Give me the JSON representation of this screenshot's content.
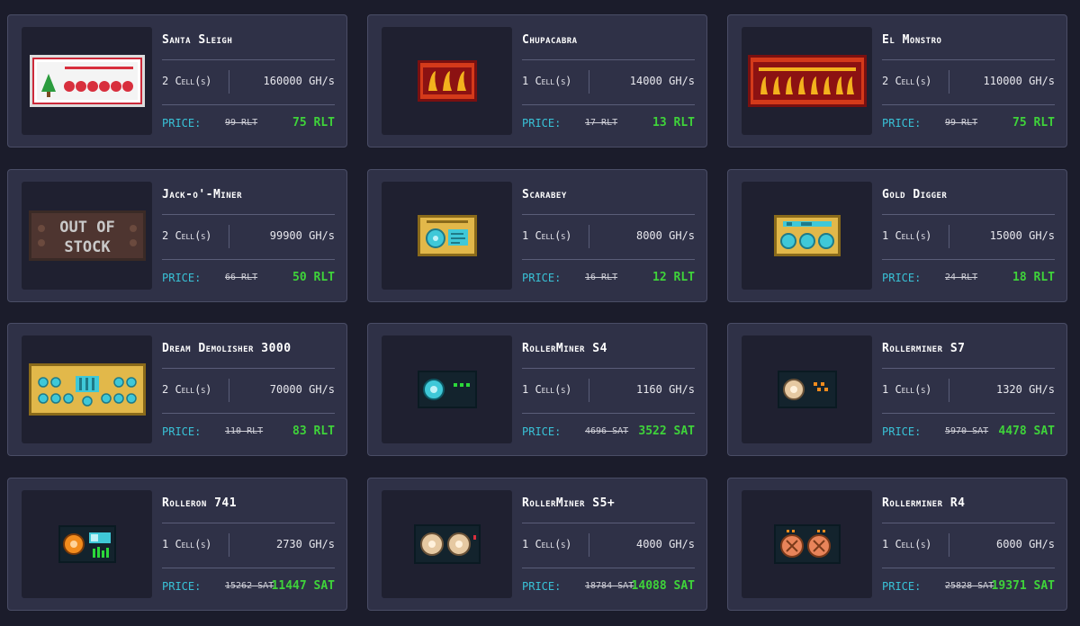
{
  "labels": {
    "price": "PRICE:"
  },
  "items": [
    {
      "name": "Santa Sleigh",
      "cells": "2 Cell(s)",
      "power": "160000 GH/s",
      "old_price": "99 RLT",
      "new_price": "75 RLT",
      "icon": "santa-sleigh-miner-icon"
    },
    {
      "name": "Chupacabra",
      "cells": "1 Cell(s)",
      "power": "14000 GH/s",
      "old_price": "17 RLT",
      "new_price": "13 RLT",
      "icon": "chupacabra-miner-icon"
    },
    {
      "name": "El Monstro",
      "cells": "2 Cell(s)",
      "power": "110000 GH/s",
      "old_price": "99 RLT",
      "new_price": "75 RLT",
      "icon": "el-monstro-miner-icon"
    },
    {
      "name": "Jack-o'-Miner",
      "cells": "2 Cell(s)",
      "power": "99900 GH/s",
      "old_price": "66 RLT",
      "new_price": "50 RLT",
      "icon": "out-of-stock-icon",
      "badge": "Out of Stock"
    },
    {
      "name": "Scarabey",
      "cells": "1 Cell(s)",
      "power": "8000 GH/s",
      "old_price": "16 RLT",
      "new_price": "12 RLT",
      "icon": "scarabey-miner-icon"
    },
    {
      "name": "Gold Digger",
      "cells": "1 Cell(s)",
      "power": "15000 GH/s",
      "old_price": "24 RLT",
      "new_price": "18 RLT",
      "icon": "gold-digger-miner-icon"
    },
    {
      "name": "Dream Demolisher 3000",
      "cells": "2 Cell(s)",
      "power": "70000 GH/s",
      "old_price": "110 RLT",
      "new_price": "83 RLT",
      "icon": "dream-demolisher-miner-icon"
    },
    {
      "name": "RollerMiner S4",
      "cells": "1 Cell(s)",
      "power": "1160 GH/s",
      "old_price": "4696 SAT",
      "new_price": "3522 SAT",
      "icon": "rollerminer-s4-icon"
    },
    {
      "name": "Rollerminer S7",
      "cells": "1 Cell(s)",
      "power": "1320 GH/s",
      "old_price": "5970 SAT",
      "new_price": "4478 SAT",
      "icon": "rollerminer-s7-icon"
    },
    {
      "name": "Rolleron 741",
      "cells": "1 Cell(s)",
      "power": "2730 GH/s",
      "old_price": "15262 SAT",
      "new_price": "11447 SAT",
      "icon": "rolleron-741-icon"
    },
    {
      "name": "RollerMiner S5+",
      "cells": "1 Cell(s)",
      "power": "4000 GH/s",
      "old_price": "18784 SAT",
      "new_price": "14088 SAT",
      "icon": "rollerminer-s5plus-icon"
    },
    {
      "name": "Rollerminer R4",
      "cells": "1 Cell(s)",
      "power": "6000 GH/s",
      "old_price": "25828 SAT",
      "new_price": "19371 SAT",
      "icon": "rollerminer-r4-icon"
    }
  ]
}
